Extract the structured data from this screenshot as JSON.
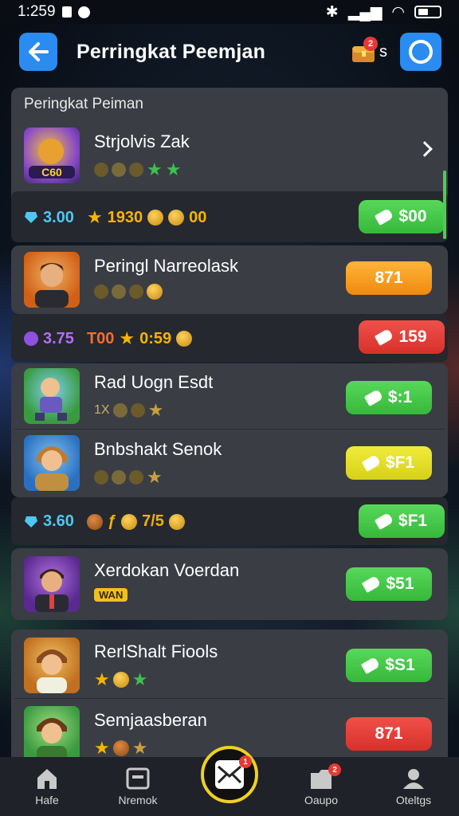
{
  "status": {
    "time": "1:25:9",
    "time_display": "1:259"
  },
  "header": {
    "title": "Perringkat Peemjan",
    "chest_badge": "2",
    "chest_suffix": "s"
  },
  "section_title": "Peringkat Peiman",
  "players": [
    {
      "name": "Strjolvis Zak",
      "price": ""
    },
    {
      "name": "Peringl Narreolask",
      "price": "871"
    },
    {
      "name": "Rad Uogn Esdt",
      "price": "$:1",
      "sub": "1X"
    },
    {
      "name": "Bnbshakt Senok",
      "price": "$F1"
    },
    {
      "name": "Xerdokan Voerdan",
      "price": "$51",
      "badge": "WAN"
    },
    {
      "name": "RerlShalt Fiools",
      "price": "$S1"
    },
    {
      "name": "Semjaasberan",
      "price": "871"
    }
  ],
  "stats": [
    {
      "gem_value": "3.00",
      "mid": "1930",
      "end": "00",
      "price": "$00"
    },
    {
      "gem_value": "3.75",
      "mid": "T00",
      "time": "0:59",
      "price": "159"
    },
    {
      "gem_value": "3.60",
      "mid": "7/5",
      "price": "$F1"
    }
  ],
  "nav": {
    "items": [
      "Hafe",
      "Nremok",
      "",
      "Oaupo",
      "Oteltgs"
    ],
    "center_badge": "1",
    "oaupo_badge": "2"
  },
  "colors": {
    "green": "#4ccf50",
    "orange": "#f59a20",
    "red": "#e53935",
    "yellow": "#e6e020",
    "accent": "#2a8cf0"
  }
}
